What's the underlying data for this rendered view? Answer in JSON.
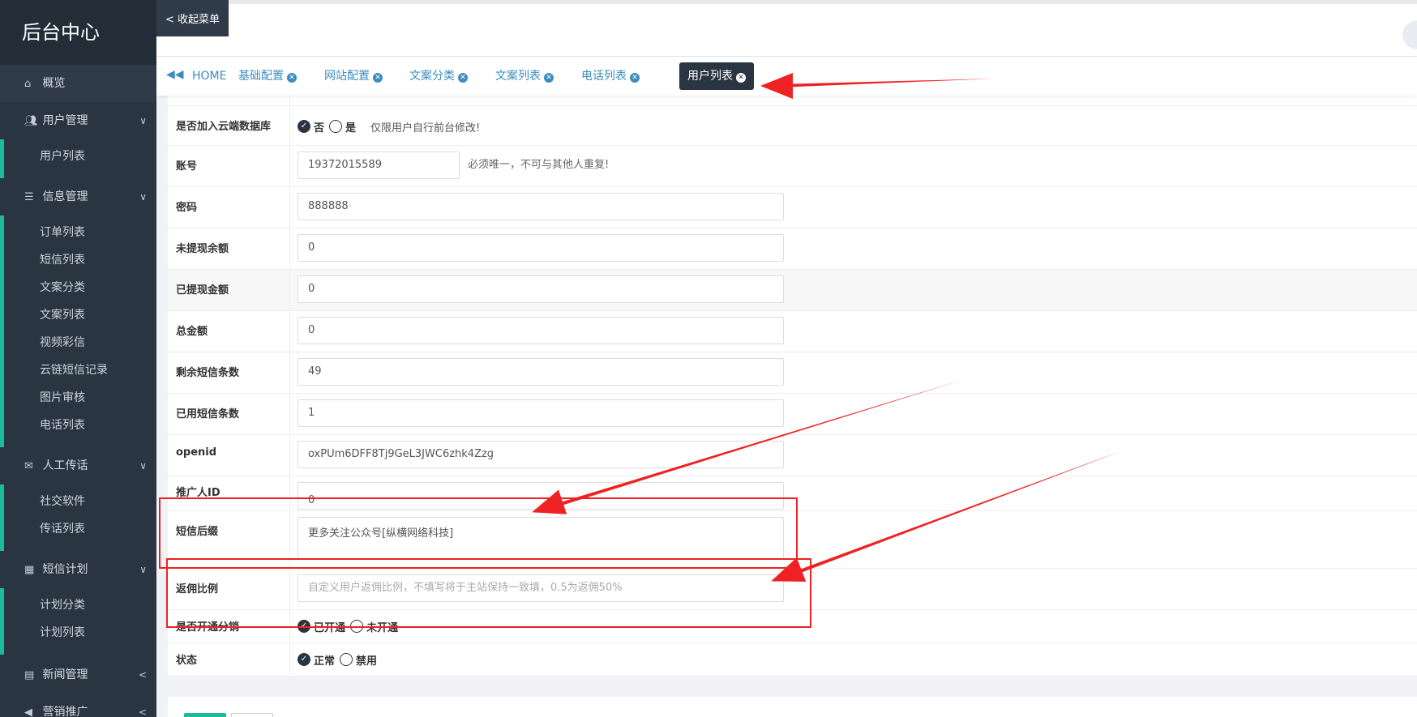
{
  "sidebar": {
    "brand": "后台中心",
    "overview": "概览",
    "groups": [
      {
        "label": "用户管理",
        "icon": "users-icon",
        "items": [
          "用户列表"
        ]
      },
      {
        "label": "信息管理",
        "icon": "list-icon",
        "items": [
          "订单列表",
          "短信列表",
          "文案分类",
          "文案列表",
          "视频彩信",
          "云链短信记录",
          "图片审核",
          "电话列表"
        ]
      },
      {
        "label": "人工传话",
        "icon": "envelope-icon",
        "items": [
          "社交软件",
          "传话列表"
        ]
      },
      {
        "label": "短信计划",
        "icon": "calendar-icon",
        "items": [
          "计划分类",
          "计划列表"
        ]
      }
    ],
    "collapsed": [
      {
        "label": "新闻管理",
        "icon": "newspaper-icon"
      },
      {
        "label": "营销推广",
        "icon": "bullhorn-icon"
      }
    ]
  },
  "topbar": {
    "collapse_label": "< 收起菜单"
  },
  "tabs": [
    {
      "label": "HOME",
      "closable": false
    },
    {
      "label": "基础配置",
      "closable": true
    },
    {
      "label": "网站配置",
      "closable": true
    },
    {
      "label": "文案分类",
      "closable": true
    },
    {
      "label": "文案列表",
      "closable": true
    },
    {
      "label": "电话列表",
      "closable": true
    },
    {
      "label": "用户列表",
      "closable": true,
      "active": true
    }
  ],
  "form": {
    "cloud": {
      "label": "是否加入云端数据库",
      "opt_no": "否",
      "opt_yes": "是",
      "selected": "否",
      "note": "仅限用户自行前台修改!"
    },
    "account": {
      "label": "账号",
      "value": "19372015589",
      "hint": "必须唯一，不可与其他人重复!"
    },
    "password": {
      "label": "密码",
      "value": "888888"
    },
    "unwithdrawn": {
      "label": "未提现余额",
      "value": "0"
    },
    "withdrawn": {
      "label": "已提现金额",
      "value": "0"
    },
    "total": {
      "label": "总金额",
      "value": "0"
    },
    "sms_left": {
      "label": "剩余短信条数",
      "value": "49"
    },
    "sms_used": {
      "label": "已用短信条数",
      "value": "1"
    },
    "openid": {
      "label": "openid",
      "value": "oxPUm6DFF8Tj9GeL3JWC6zhk4Zzg"
    },
    "promoter": {
      "label": "推广人ID",
      "value": "0"
    },
    "suffix": {
      "label": "短信后缀",
      "value": "更多关注公众号[纵横网络科技]"
    },
    "rebate": {
      "label": "返佣比例",
      "placeholder": "自定义用户返佣比例，不填写将于主站保持一致填，0.5为返佣50%"
    },
    "distribution": {
      "label": "是否开通分销",
      "opt_on": "已开通",
      "opt_off": "未开通",
      "selected": "已开通"
    },
    "status": {
      "label": "状态",
      "opt_normal": "正常",
      "opt_disabled": "禁用",
      "selected": "正常"
    }
  },
  "colors": {
    "sidebar_bg": "#2a3542",
    "accent": "#1abc9c",
    "tab_link": "#3c8dbc",
    "annotation": "#ee2222"
  }
}
